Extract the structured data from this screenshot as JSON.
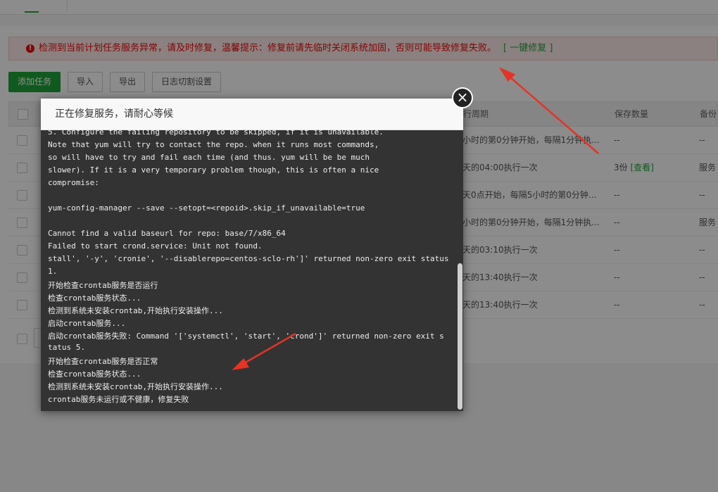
{
  "alert": {
    "icon": "error-circle-icon",
    "message": "检测到当前计划任务服务异常，请及时修复，温馨提示：修复前请先临时关闭系统加固，否则可能导致修复失败。",
    "fix_link": "[ 一键修复 ]"
  },
  "toolbar": {
    "add_task": "添加任务",
    "import": "导入",
    "export": "导出",
    "log_split": "日志切割设置"
  },
  "table": {
    "headers": {
      "cycle": "行周期",
      "keep": "保存数量",
      "backup": "备份"
    },
    "rows": [
      {
        "cycle": "小时的第0分钟开始，每隔1分钟执...",
        "keep": "--",
        "backup": "--",
        "link": ""
      },
      {
        "cycle": "天的04:00执行一次",
        "keep": "3份",
        "backup": "服务",
        "link": "[查看]"
      },
      {
        "cycle": "天0点开始，每隔5小时的第0分钟...",
        "keep": "--",
        "backup": "--",
        "link": ""
      },
      {
        "cycle": "小时的第0分钟开始，每隔1分钟执...",
        "keep": "--",
        "backup": "服务",
        "link": ""
      },
      {
        "cycle": "天的03:10执行一次",
        "keep": "--",
        "backup": "--",
        "link": ""
      },
      {
        "cycle": "天的13:40执行一次",
        "keep": "--",
        "backup": "--",
        "link": ""
      },
      {
        "cycle": "天的13:40执行一次",
        "keep": "--",
        "backup": "--",
        "link": ""
      }
    ]
  },
  "dialog": {
    "title": "正在修复服务，请耐心等候",
    "close_icon": "close-circle-icon",
    "log_lines": [
      "5. Configure the failing repository to be skipped, if it is unavailable.",
      "Note that yum will try to contact the repo. when it runs most commands,",
      "so will have to try and fail each time (and thus. yum will be be much",
      "slower). If it is a very temporary problem though, this is often a nice",
      "compromise:",
      "",
      "yum-config-manager --save --setopt=<repoid>.skip_if_unavailable=true",
      "",
      "Cannot find a valid baseurl for repo: base/7/x86_64",
      "Failed to start crond.service: Unit not found.",
      "stall', '-y', 'cronie', '--disablerepo=centos-sclo-rh']' returned non-zero exit status",
      "1.",
      "开始检查crontab服务是否运行",
      "检查crontab服务状态...",
      "检测到系统未安装crontab,开始执行安装操作...",
      "启动crontab服务...",
      "启动crontab服务失败: Command '['systemctl', 'start', 'crond']' returned non-zero exit s",
      "tatus 5.",
      "开始检查crontab服务是否正常",
      "检查crontab服务状态...",
      "检测到系统未安装crontab,开始执行安装操作...",
      "crontab服务未运行或不健康，修复失败"
    ]
  },
  "colors": {
    "accent": "#20a53a",
    "error": "#ef0808",
    "annotation": "#e53325",
    "console_bg": "#333333"
  }
}
